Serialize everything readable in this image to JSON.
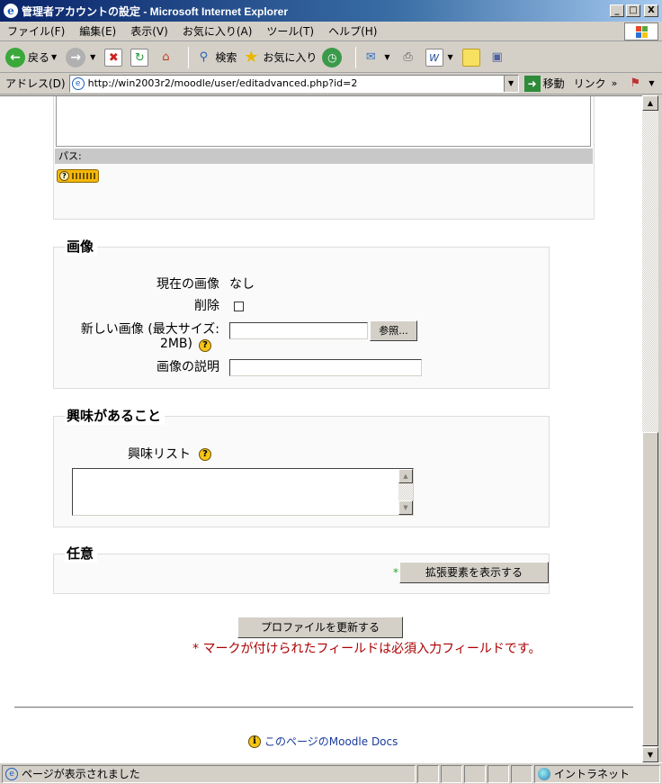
{
  "window": {
    "title": "管理者アカウントの設定 - Microsoft Internet Explorer",
    "minimize": "_",
    "maximize": "□",
    "close": "X"
  },
  "menu": [
    "ファイル(F)",
    "編集(E)",
    "表示(V)",
    "お気に入り(A)",
    "ツール(T)",
    "ヘルプ(H)"
  ],
  "toolbar": {
    "back": "戻る",
    "search": "検索",
    "favorites": "お気に入り"
  },
  "address": {
    "label": "アドレス(D)",
    "url": "http://win2003r2/moodle/user/editadvanced.php?id=2",
    "go": "移動",
    "links": "リンク"
  },
  "editor": {
    "path_label": "パス:"
  },
  "image_section": {
    "legend": "画像",
    "current_label": "現在の画像",
    "current_value": "なし",
    "delete_label": "削除",
    "new_label_line1": "新しい画像 (最大サイズ:",
    "new_label_line2": "2MB)",
    "browse_button": "参照...",
    "description_label": "画像の説明"
  },
  "interests_section": {
    "legend": "興味があること",
    "list_label": "興味リスト"
  },
  "optional_section": {
    "legend": "任意",
    "required_mark": "*",
    "show_advanced_button": "拡張要素を表示する"
  },
  "form": {
    "submit_button": "プロファイルを更新する",
    "required_note": "* マークが付けられたフィールドは必須入力フィールドです。"
  },
  "footer": {
    "docs_link": "このページのMoodle Docs"
  },
  "status": {
    "text": "ページが表示されました",
    "zone": "イントラネット"
  }
}
